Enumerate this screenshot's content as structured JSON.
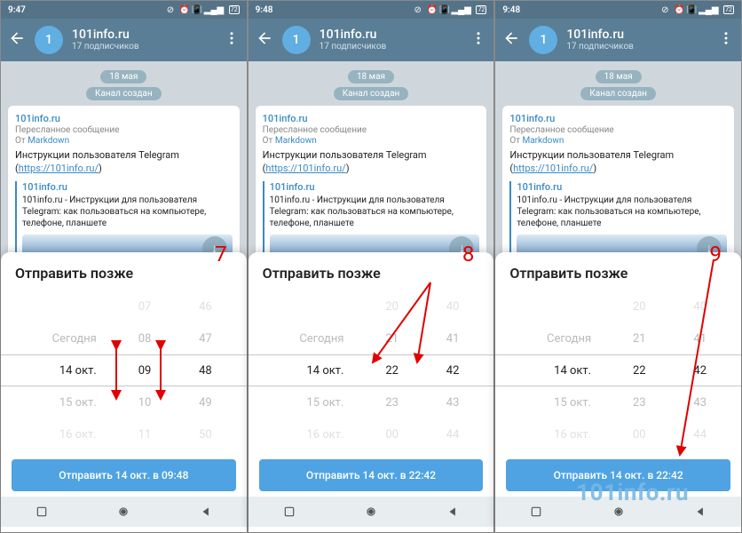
{
  "watermark": "101info.ru",
  "annotations": {
    "step7": "7",
    "step8": "8",
    "step9": "9"
  },
  "screen1": {
    "status": {
      "time": "9:47",
      "battery": "72"
    },
    "header": {
      "avatar": "1",
      "title": "101info.ru",
      "subtitle": "17 подписчиков"
    },
    "chat": {
      "date": "18 мая",
      "system": "Канал создан",
      "msg": {
        "sender": "101info.ru",
        "fwd_label": "Пересланное сообщение",
        "fwd_from_prefix": "От",
        "fwd_from": "Markdown",
        "text_prefix": "Инструкции пользователя Telegram (",
        "link": "https://101info.ru/",
        "text_suffix": ")",
        "preview_title": "101info.ru",
        "preview_desc": "101info.ru - Инструкции для пользователя Telegram: как пользоваться на компьютере, телефоне, планшете"
      }
    },
    "sheet": {
      "title": "Отправить позже",
      "picker": {
        "days": [
          "",
          "Сегодня",
          "14 окт.",
          "15 окт.",
          "16 окт."
        ],
        "hours": [
          "07",
          "08",
          "09",
          "10",
          "11"
        ],
        "mins": [
          "46",
          "47",
          "48",
          "49",
          "50"
        ]
      },
      "send": "Отправить 14 окт. в 09:48"
    }
  },
  "screen2": {
    "status": {
      "time": "9:48",
      "battery": "72"
    },
    "header": {
      "avatar": "1",
      "title": "101info.ru",
      "subtitle": "17 подписчиков"
    },
    "chat": {
      "date": "18 мая",
      "system": "Канал создан",
      "msg": {
        "sender": "101info.ru",
        "fwd_label": "Пересланное сообщение",
        "fwd_from_prefix": "От",
        "fwd_from": "Markdown",
        "text_prefix": "Инструкции пользователя Telegram (",
        "link": "https://101info.ru/",
        "text_suffix": ")",
        "preview_title": "101info.ru",
        "preview_desc": "101info.ru - Инструкции для пользователя Telegram: как пользоваться на компьютере, телефоне, планшете"
      }
    },
    "sheet": {
      "title": "Отправить позже",
      "picker": {
        "days": [
          "",
          "Сегодня",
          "14 окт.",
          "15 окт.",
          "16 окт."
        ],
        "hours": [
          "20",
          "21",
          "22",
          "23",
          "00"
        ],
        "mins": [
          "40",
          "41",
          "42",
          "43",
          "44"
        ]
      },
      "send": "Отправить 14 окт. в 22:42"
    }
  },
  "screen3": {
    "status": {
      "time": "9:48",
      "battery": "72"
    },
    "header": {
      "avatar": "1",
      "title": "101info.ru",
      "subtitle": "17 подписчиков"
    },
    "chat": {
      "date": "18 мая",
      "system": "Канал создан",
      "msg": {
        "sender": "101info.ru",
        "fwd_label": "Пересланное сообщение",
        "fwd_from_prefix": "От",
        "fwd_from": "Markdown",
        "text_prefix": "Инструкции пользователя Telegram (",
        "link": "https://101info.ru/",
        "text_suffix": ")",
        "preview_title": "101info.ru",
        "preview_desc": "101info.ru - Инструкции для пользователя Telegram: как пользоваться на компьютере, телефоне, планшете"
      }
    },
    "sheet": {
      "title": "Отправить позже",
      "picker": {
        "days": [
          "",
          "Сегодня",
          "14 окт.",
          "15 окт.",
          "16 окт."
        ],
        "hours": [
          "20",
          "21",
          "22",
          "23",
          "00"
        ],
        "mins": [
          "40",
          "41",
          "42",
          "43",
          "44"
        ]
      },
      "send": "Отправить 14 окт. в 22:42"
    }
  }
}
